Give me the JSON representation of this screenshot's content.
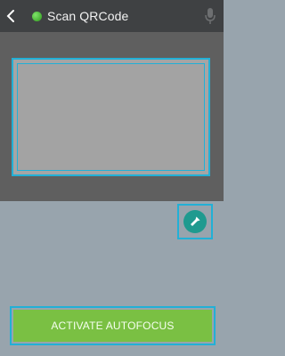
{
  "appbar": {
    "title": "Scan QRCode",
    "back_icon": "chevron-left-icon",
    "status_icon": "green-dot-icon",
    "mic_icon": "microphone-icon"
  },
  "scanner": {
    "flash_icon": "flashlight-icon"
  },
  "actions": {
    "autofocus_label": "ACTIVATE AUTOFOCUS"
  },
  "colors": {
    "appbar_bg": "#3f4143",
    "highlight": "#22b0d6",
    "button_green": "#7ac043",
    "flash_teal": "#1f9a8f"
  }
}
